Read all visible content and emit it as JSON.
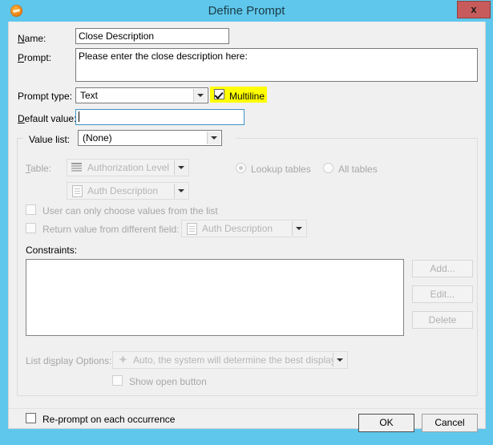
{
  "window": {
    "title": "Define Prompt",
    "icon": "app-orb-icon",
    "close_label": "x",
    "titlebar_color": "#5fc7eb",
    "close_color": "#c75b5b"
  },
  "form": {
    "name": {
      "label": "Name:",
      "accel": "N",
      "value": "Close Description"
    },
    "prompt": {
      "label": "Prompt:",
      "accel": "P",
      "value": "Please enter the close description here:"
    },
    "prompt_type": {
      "label": "Prompt type:",
      "value": "Text"
    },
    "multiline": {
      "label": "Multiline",
      "checked": true,
      "highlight_color": "#ffff00"
    },
    "default_value": {
      "label": "Default value:",
      "accel": "D",
      "value": ""
    }
  },
  "value_list": {
    "legend": "Value list:",
    "selected": "(None)",
    "table": {
      "label": "Table:",
      "accel": "T",
      "value": "Authorization Level",
      "icon": "table-icon",
      "disabled": true
    },
    "field": {
      "value": "Auth Description",
      "icon": "document-icon",
      "disabled": true
    },
    "scope": {
      "lookup_tables": "Lookup tables",
      "all_tables": "All tables",
      "selected": "Lookup tables"
    },
    "only_from_list": {
      "label": "User can only choose values from the list",
      "checked": false,
      "disabled": true
    },
    "return_different_field": {
      "label": "Return value from different field:",
      "checked": false,
      "disabled": true,
      "value": "Auth Description",
      "icon": "document-icon"
    },
    "constraints": {
      "label": "Constraints:",
      "items": [],
      "buttons": [
        {
          "label": "Add...",
          "name": "add-constraint-button",
          "disabled": true
        },
        {
          "label": "Edit...",
          "name": "edit-constraint-button",
          "disabled": true
        },
        {
          "label": "Delete",
          "name": "delete-constraint-button",
          "disabled": true
        }
      ]
    },
    "list_display": {
      "label": "List display Options:",
      "accel": "s",
      "value": "Auto, the system will determine the best display",
      "icon": "wand-icon",
      "disabled": true
    },
    "show_open_button": {
      "label": "Show open button",
      "checked": false,
      "disabled": true
    }
  },
  "reprompt": {
    "label": "Re-prompt on each occurrence",
    "checked": false
  },
  "footer": {
    "ok": "OK",
    "cancel": "Cancel"
  }
}
